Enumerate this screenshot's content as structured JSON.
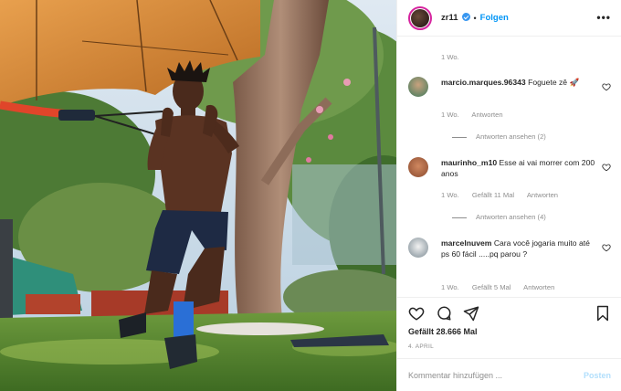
{
  "post": {
    "username": "zr11",
    "follow_separator": "•",
    "follow_label": "Folgen",
    "more_icon": "more-horizontal-icon"
  },
  "comments": [
    {
      "username": "",
      "text": "",
      "time": "1 Wo.",
      "likes": "",
      "reply_label": "",
      "view_replies": ""
    },
    {
      "username": "marcio.marques.96343",
      "text": "Foguete zê 🚀",
      "time": "1 Wo.",
      "likes": "",
      "reply_label": "Antworten",
      "view_replies": "Antworten ansehen (2)"
    },
    {
      "username": "maurinho_m10",
      "text": "Esse ai vai morrer com 200 anos",
      "time": "1 Wo.",
      "likes": "Gefällt 11 Mal",
      "reply_label": "Antworten",
      "view_replies": "Antworten ansehen (4)"
    },
    {
      "username": "marcelnuvem",
      "text": "Cara você jogaria muito até ps 60 fácil .....pq parou ?",
      "time": "1 Wo.",
      "likes": "Gefällt 5 Mal",
      "reply_label": "Antworten",
      "view_replies": ""
    }
  ],
  "actions": {
    "like_icon": "heart-icon",
    "comment_icon": "comment-icon",
    "share_icon": "paper-plane-icon",
    "save_icon": "bookmark-icon"
  },
  "likes_text": "Gefällt 28.666 Mal",
  "date_text": "4. APRIL",
  "add_comment": {
    "placeholder": "Kommentar hinzufügen ...",
    "post_label": "Posten"
  },
  "colors": {
    "link_blue": "#0095f6",
    "disabled_blue": "#b2dffc",
    "meta_gray": "#8e8e8e",
    "border": "#efefef"
  }
}
